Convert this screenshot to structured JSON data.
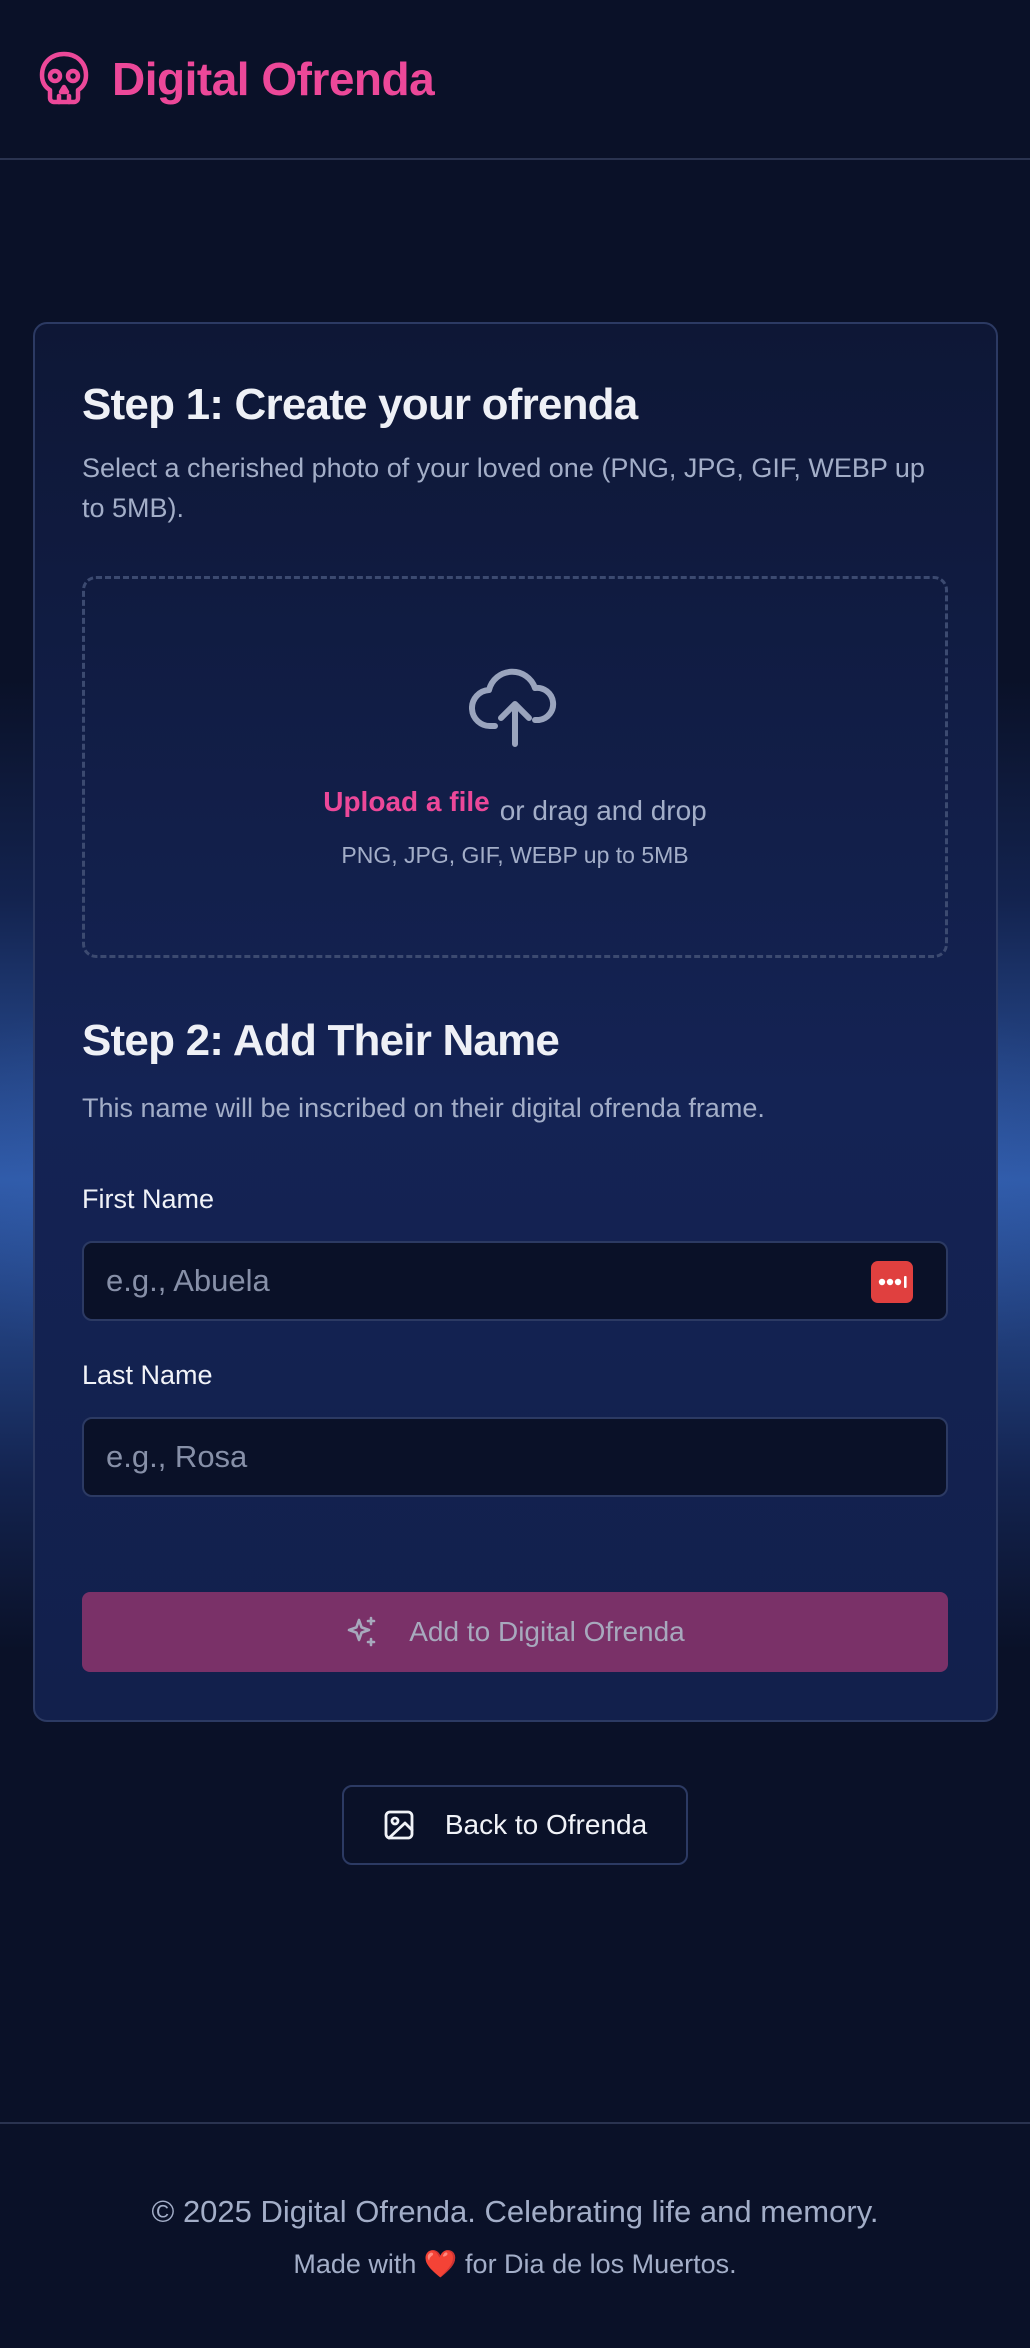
{
  "header": {
    "brand": "Digital Ofrenda",
    "logo_icon": "skull-icon"
  },
  "step1": {
    "title": "Step 1: Create your ofrenda",
    "description": "Select a cherished photo of your loved one (PNG, JPG, GIF, WEBP up to 5MB).",
    "upload_icon": "cloud-upload-icon",
    "upload_link": "Upload a file",
    "upload_rest": "or drag and drop",
    "upload_hint": "PNG, JPG, GIF, WEBP up to 5MB"
  },
  "step2": {
    "title": "Step 2: Add Their Name",
    "description": "This name will be inscribed on their digital ofrenda frame.",
    "first_name_label": "First Name",
    "first_name_placeholder": "e.g., Abuela",
    "first_name_value": "",
    "last_name_label": "Last Name",
    "last_name_placeholder": "e.g., Rosa",
    "last_name_value": ""
  },
  "submit": {
    "label": "Add to Digital Ofrenda",
    "icon": "sparkles-icon"
  },
  "back": {
    "label": "Back to Ofrenda",
    "icon": "image-icon"
  },
  "footer": {
    "copyright": "© 2025 Digital Ofrenda. Celebrating life and memory.",
    "made_with_prefix": "Made with",
    "heart": "❤️",
    "made_with_suffix": "for Dia de los Muertos."
  },
  "colors": {
    "brand_pink": "#ec4899",
    "background": "#0a1128",
    "button_disabled": "#7a3168"
  }
}
